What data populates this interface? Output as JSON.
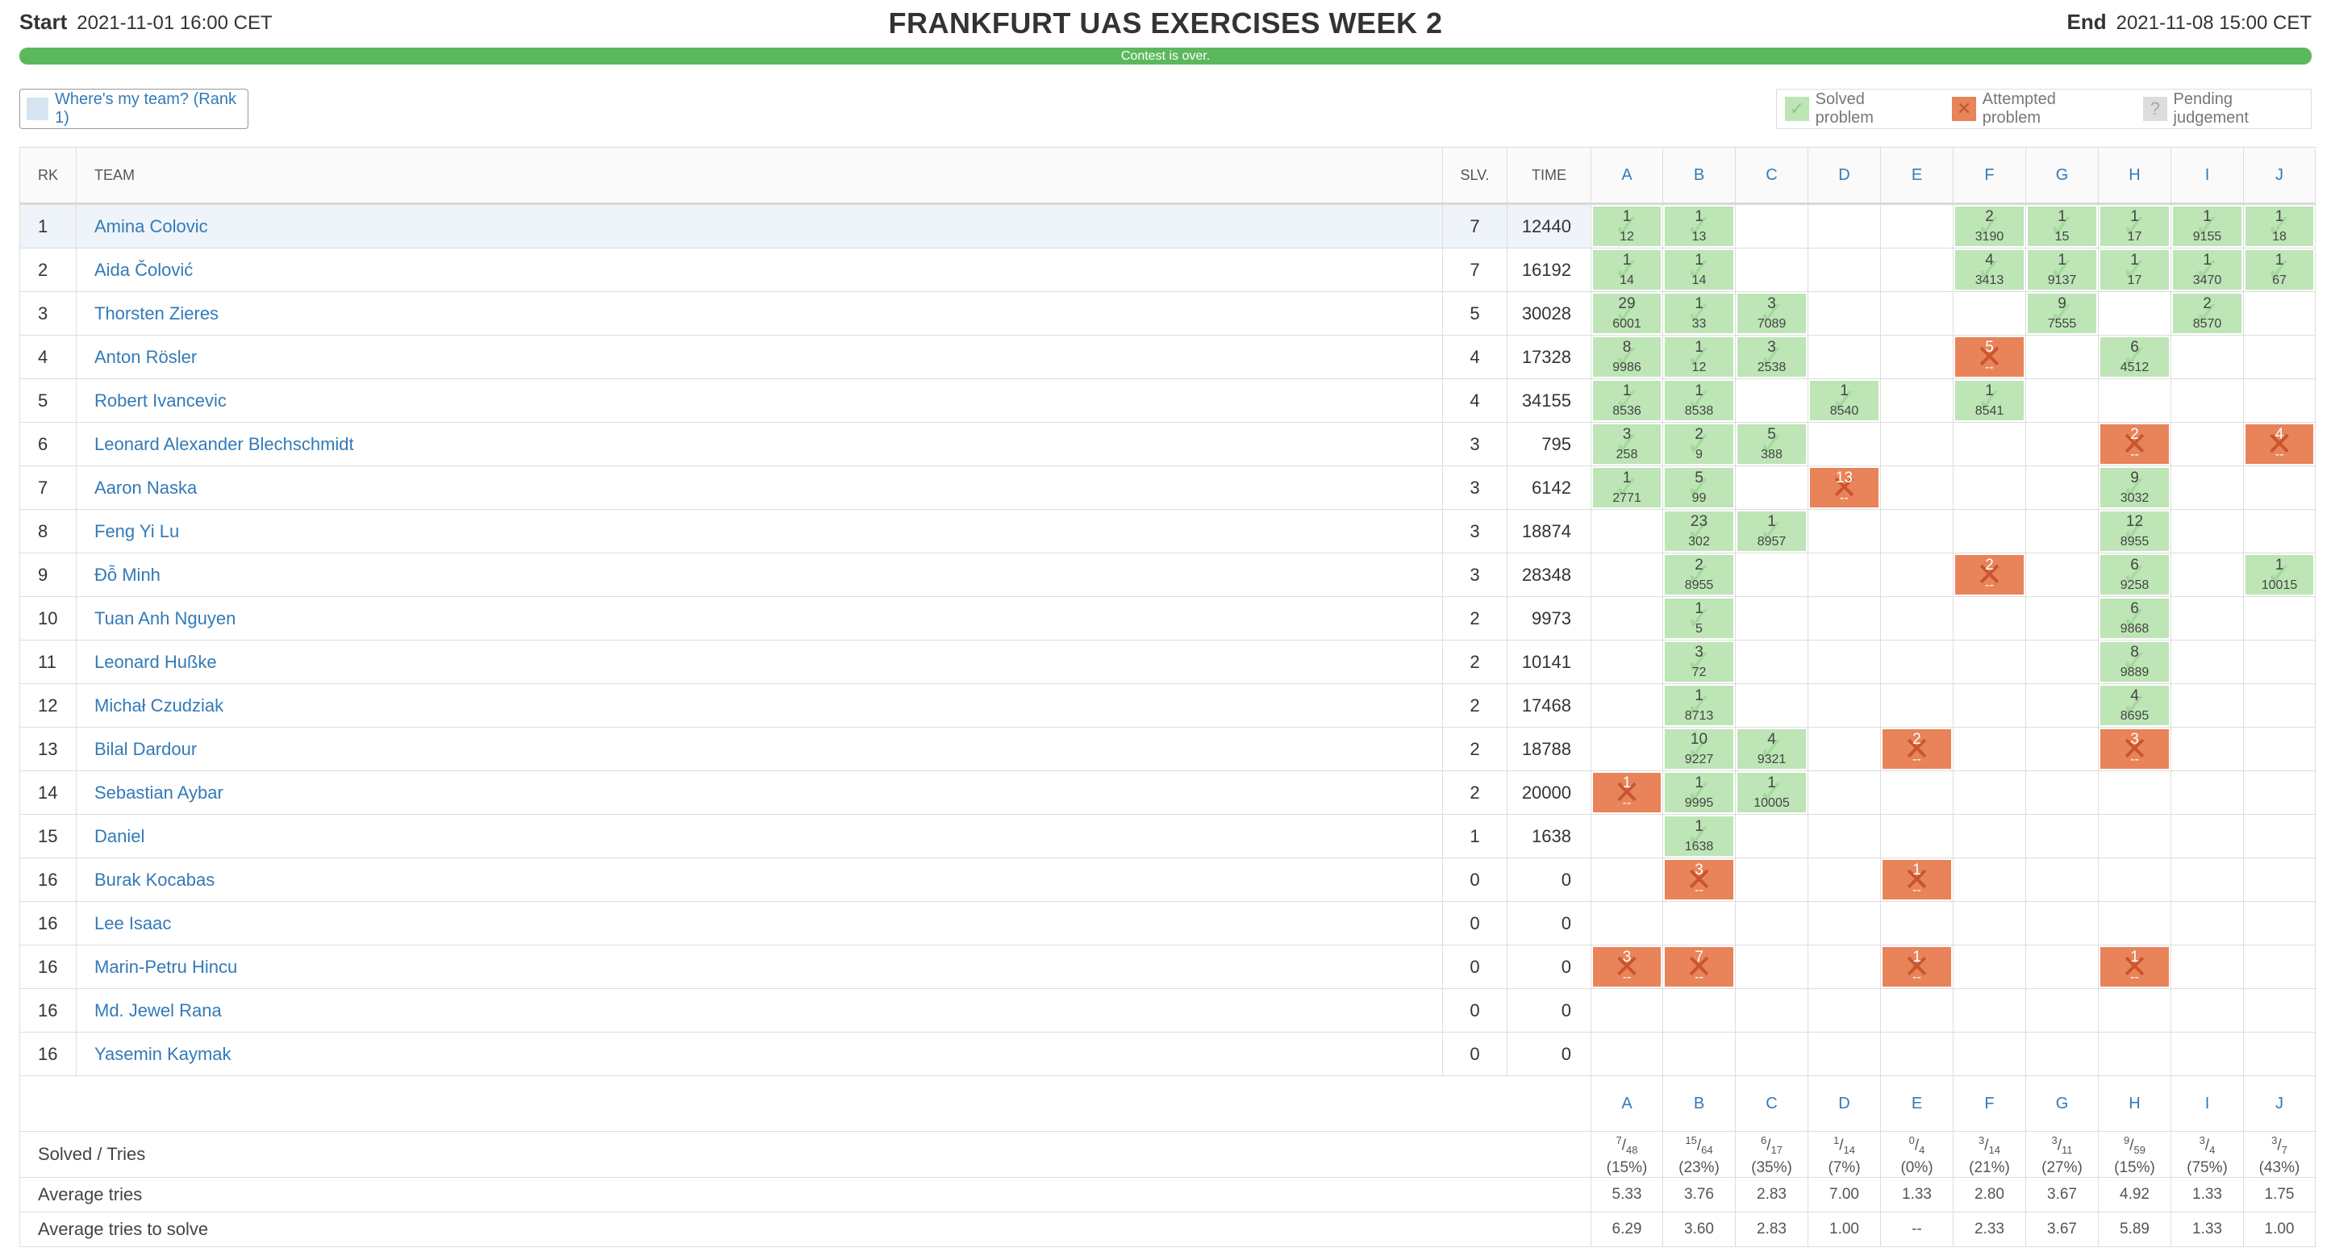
{
  "contest": {
    "start_label": "Start",
    "start_time": "2021-11-01 16:00 CET",
    "title": "FRANKFURT UAS EXERCISES WEEK 2",
    "end_label": "End",
    "end_time": "2021-11-08 15:00 CET",
    "progress_text": "Contest is over.",
    "progress_fraction": 1.0
  },
  "where_team": {
    "label": "Where's my team? (Rank 1)"
  },
  "legend": {
    "solved": "Solved problem",
    "attempted": "Attempted problem",
    "pending": "Pending judgement"
  },
  "headers": {
    "rk": "RK",
    "team": "TEAM",
    "slv": "SLV.",
    "time": "TIME"
  },
  "problems": [
    "A",
    "B",
    "C",
    "D",
    "E",
    "F",
    "G",
    "H",
    "I",
    "J"
  ],
  "rows": [
    {
      "rank": "1",
      "team": "Amina Colovic",
      "solved": "7",
      "time": "12440",
      "cells": {
        "A": [
          "s",
          "1",
          "12"
        ],
        "B": [
          "s",
          "1",
          "13"
        ],
        "F": [
          "s",
          "2",
          "3190"
        ],
        "G": [
          "s",
          "1",
          "15"
        ],
        "H": [
          "s",
          "1",
          "17"
        ],
        "I": [
          "s",
          "1",
          "9155"
        ],
        "J": [
          "s",
          "1",
          "18"
        ]
      }
    },
    {
      "rank": "2",
      "team": "Aida Čolović",
      "solved": "7",
      "time": "16192",
      "cells": {
        "A": [
          "s",
          "1",
          "14"
        ],
        "B": [
          "s",
          "1",
          "14"
        ],
        "F": [
          "s",
          "4",
          "3413"
        ],
        "G": [
          "s",
          "1",
          "9137"
        ],
        "H": [
          "s",
          "1",
          "17"
        ],
        "I": [
          "s",
          "1",
          "3470"
        ],
        "J": [
          "s",
          "1",
          "67"
        ]
      }
    },
    {
      "rank": "3",
      "team": "Thorsten Zieres",
      "solved": "5",
      "time": "30028",
      "cells": {
        "A": [
          "s",
          "29",
          "6001"
        ],
        "B": [
          "s",
          "1",
          "33"
        ],
        "C": [
          "s",
          "3",
          "7089"
        ],
        "G": [
          "s",
          "9",
          "7555"
        ],
        "I": [
          "s",
          "2",
          "8570"
        ]
      }
    },
    {
      "rank": "4",
      "team": "Anton Rösler",
      "solved": "4",
      "time": "17328",
      "cells": {
        "A": [
          "s",
          "8",
          "9986"
        ],
        "B": [
          "s",
          "1",
          "12"
        ],
        "C": [
          "s",
          "3",
          "2538"
        ],
        "F": [
          "f",
          "5",
          "--"
        ],
        "H": [
          "s",
          "6",
          "4512"
        ]
      }
    },
    {
      "rank": "5",
      "team": "Robert Ivancevic",
      "solved": "4",
      "time": "34155",
      "cells": {
        "A": [
          "s",
          "1",
          "8536"
        ],
        "B": [
          "s",
          "1",
          "8538"
        ],
        "D": [
          "s",
          "1",
          "8540"
        ],
        "F": [
          "s",
          "1",
          "8541"
        ]
      }
    },
    {
      "rank": "6",
      "team": "Leonard Alexander Blechschmidt",
      "solved": "3",
      "time": "795",
      "cells": {
        "A": [
          "s",
          "3",
          "258"
        ],
        "B": [
          "s",
          "2",
          "9"
        ],
        "C": [
          "s",
          "5",
          "388"
        ],
        "H": [
          "f",
          "2",
          "--"
        ],
        "J": [
          "f",
          "4",
          "--"
        ]
      }
    },
    {
      "rank": "7",
      "team": "Aaron Naska",
      "solved": "3",
      "time": "6142",
      "cells": {
        "A": [
          "s",
          "1",
          "2771"
        ],
        "B": [
          "s",
          "5",
          "99"
        ],
        "D": [
          "f",
          "13",
          "--"
        ],
        "H": [
          "s",
          "9",
          "3032"
        ]
      }
    },
    {
      "rank": "8",
      "team": "Feng Yi Lu",
      "solved": "3",
      "time": "18874",
      "cells": {
        "B": [
          "s",
          "23",
          "302"
        ],
        "C": [
          "s",
          "1",
          "8957"
        ],
        "H": [
          "s",
          "12",
          "8955"
        ]
      }
    },
    {
      "rank": "9",
      "team": "Đỗ Minh",
      "solved": "3",
      "time": "28348",
      "cells": {
        "B": [
          "s",
          "2",
          "8955"
        ],
        "F": [
          "f",
          "2",
          "--"
        ],
        "H": [
          "s",
          "6",
          "9258"
        ],
        "J": [
          "s",
          "1",
          "10015"
        ]
      }
    },
    {
      "rank": "10",
      "team": "Tuan Anh Nguyen",
      "solved": "2",
      "time": "9973",
      "cells": {
        "B": [
          "s",
          "1",
          "5"
        ],
        "H": [
          "s",
          "6",
          "9868"
        ]
      }
    },
    {
      "rank": "11",
      "team": "Leonard Hußke",
      "solved": "2",
      "time": "10141",
      "cells": {
        "B": [
          "s",
          "3",
          "72"
        ],
        "H": [
          "s",
          "8",
          "9889"
        ]
      }
    },
    {
      "rank": "12",
      "team": "Michał Czudziak",
      "solved": "2",
      "time": "17468",
      "cells": {
        "B": [
          "s",
          "1",
          "8713"
        ],
        "H": [
          "s",
          "4",
          "8695"
        ]
      }
    },
    {
      "rank": "13",
      "team": "Bilal Dardour",
      "solved": "2",
      "time": "18788",
      "cells": {
        "B": [
          "s",
          "10",
          "9227"
        ],
        "C": [
          "s",
          "4",
          "9321"
        ],
        "E": [
          "f",
          "2",
          "--"
        ],
        "H": [
          "f",
          "3",
          "--"
        ]
      }
    },
    {
      "rank": "14",
      "team": "Sebastian Aybar",
      "solved": "2",
      "time": "20000",
      "cells": {
        "A": [
          "f",
          "1",
          "--"
        ],
        "B": [
          "s",
          "1",
          "9995"
        ],
        "C": [
          "s",
          "1",
          "10005"
        ]
      }
    },
    {
      "rank": "15",
      "team": "Daniel",
      "solved": "1",
      "time": "1638",
      "cells": {
        "B": [
          "s",
          "1",
          "1638"
        ]
      }
    },
    {
      "rank": "16",
      "team": "Burak Kocabas",
      "solved": "0",
      "time": "0",
      "cells": {
        "B": [
          "f",
          "3",
          "--"
        ],
        "E": [
          "f",
          "1",
          "--"
        ]
      }
    },
    {
      "rank": "16",
      "team": "Lee Isaac",
      "solved": "0",
      "time": "0",
      "cells": {}
    },
    {
      "rank": "16",
      "team": "Marin-Petru Hincu",
      "solved": "0",
      "time": "0",
      "cells": {
        "A": [
          "f",
          "3",
          "--"
        ],
        "B": [
          "f",
          "7",
          "--"
        ],
        "E": [
          "f",
          "1",
          "--"
        ],
        "H": [
          "f",
          "1",
          "--"
        ]
      }
    },
    {
      "rank": "16",
      "team": "Md. Jewel Rana",
      "solved": "0",
      "time": "0",
      "cells": {}
    },
    {
      "rank": "16",
      "team": "Yasemin Kaymak",
      "solved": "0",
      "time": "0",
      "cells": {}
    }
  ],
  "stats": {
    "solved_tries_label": "Solved / Tries",
    "avg_tries_label": "Average tries",
    "avg_tries_solve_label": "Average tries to solve",
    "solved_tries": [
      {
        "s": "7",
        "t": "48",
        "pct": "(15%)"
      },
      {
        "s": "15",
        "t": "64",
        "pct": "(23%)"
      },
      {
        "s": "6",
        "t": "17",
        "pct": "(35%)"
      },
      {
        "s": "1",
        "t": "14",
        "pct": "(7%)"
      },
      {
        "s": "0",
        "t": "4",
        "pct": "(0%)"
      },
      {
        "s": "3",
        "t": "14",
        "pct": "(21%)"
      },
      {
        "s": "3",
        "t": "11",
        "pct": "(27%)"
      },
      {
        "s": "9",
        "t": "59",
        "pct": "(15%)"
      },
      {
        "s": "3",
        "t": "4",
        "pct": "(75%)"
      },
      {
        "s": "3",
        "t": "7",
        "pct": "(43%)"
      }
    ],
    "avg_tries": [
      "5.33",
      "3.76",
      "2.83",
      "7.00",
      "1.33",
      "2.80",
      "3.67",
      "4.92",
      "1.33",
      "1.75"
    ],
    "avg_tries_solve": [
      "6.29",
      "3.60",
      "2.83",
      "1.00",
      "--",
      "2.33",
      "3.67",
      "5.89",
      "1.33",
      "1.00"
    ]
  },
  "colors": {
    "solved": "#bde5b6",
    "failed": "#e8835a",
    "pending": "#dddddd",
    "progress": "#5cb85c",
    "link": "#337ab7"
  }
}
